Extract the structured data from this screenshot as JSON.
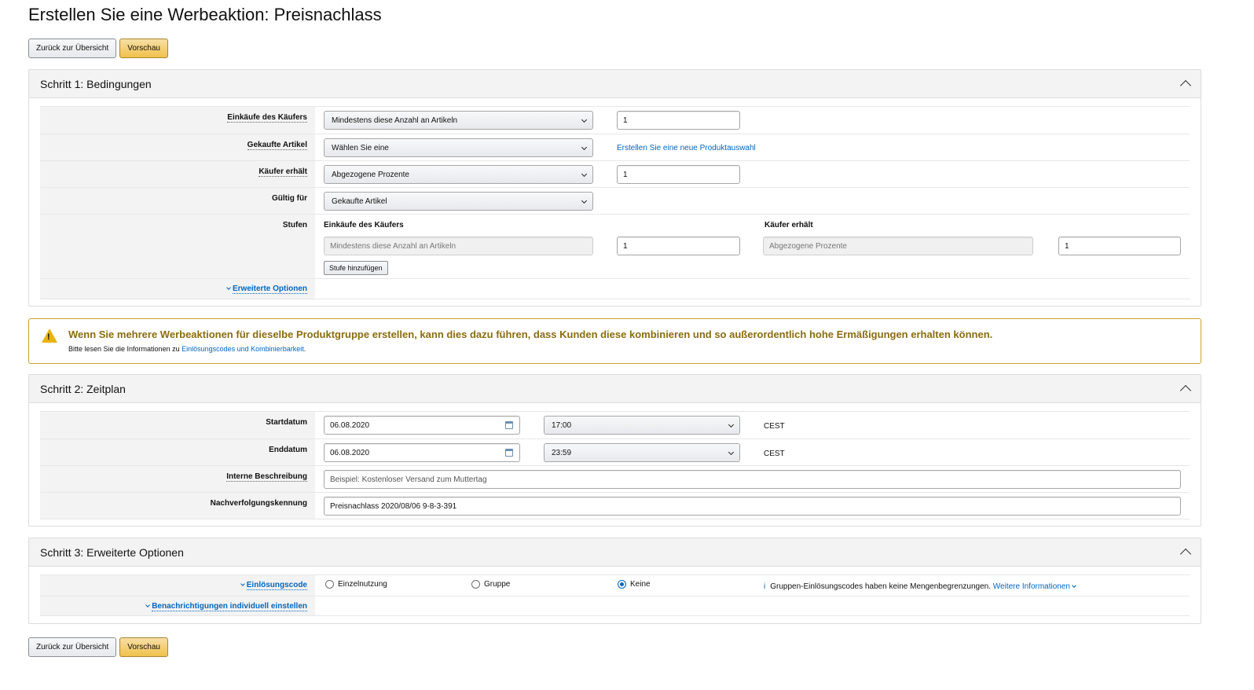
{
  "page": {
    "title": "Erstellen Sie eine Werbeaktion: Preisnachlass"
  },
  "buttons": {
    "back": "Zurück zur Übersicht",
    "preview": "Vorschau"
  },
  "step1": {
    "title": "Schritt 1: Bedingungen",
    "rows": {
      "purchases": {
        "label": "Einkäufe des Käufers",
        "select": "Mindestens diese Anzahl an Artikeln",
        "value": "1"
      },
      "items": {
        "label": "Gekaufte Artikel",
        "select": "Wählen Sie eine",
        "link": "Erstellen Sie eine neue Produktauswahl"
      },
      "receives": {
        "label": "Käufer erhält",
        "select": "Abgezogene Prozente",
        "value": "1"
      },
      "valid": {
        "label": "Gültig für",
        "select": "Gekaufte Artikel"
      },
      "tiers": {
        "label": "Stufen",
        "col1_header": "Einkäufe des Käufers",
        "col2_header": "Käufer erhält",
        "purchases_placeholder": "Mindestens diese Anzahl an Artikeln",
        "purchases_value": "1",
        "receives_placeholder": "Abgezogene Prozente",
        "receives_value": "1",
        "add_button": "Stufe hinzufügen"
      },
      "advanced": {
        "label": "Erweiterte Optionen"
      }
    }
  },
  "alert": {
    "title": "Wenn Sie mehrere Werbeaktionen für dieselbe Produktgruppe erstellen, kann dies dazu führen, dass Kunden diese kombinieren und so außerordentlich hohe Ermäßigungen erhalten können.",
    "text_prefix": "Bitte lesen Sie die Informationen zu",
    "link": "Einlösungscodes und Kombinierbarkeit",
    "text_suffix": ".",
    "icon_glyph": "!"
  },
  "step2": {
    "title": "Schritt 2: Zeitplan",
    "rows": {
      "start": {
        "label": "Startdatum",
        "date": "06.08.2020",
        "time": "17:00",
        "tz": "CEST"
      },
      "end": {
        "label": "Enddatum",
        "date": "06.08.2020",
        "time": "23:59",
        "tz": "CEST"
      },
      "internal": {
        "label": "Interne Beschreibung",
        "placeholder": "Beispiel: Kostenloser Versand zum Muttertag"
      },
      "tracking": {
        "label": "Nachverfolgungskennung",
        "value": "Preisnachlass 2020/08/06 9-8-3-391"
      }
    }
  },
  "step3": {
    "title": "Schritt 3: Erweiterte Optionen",
    "rows": {
      "code": {
        "label": "Einlösungscode",
        "options": [
          "Einzelnutzung",
          "Gruppe",
          "Keine"
        ],
        "selected": "Keine",
        "info_glyph": "i",
        "info_text": "Gruppen-Einlösungscodes haben keine Mengenbegrenzungen.",
        "info_link": "Weitere Informationen"
      },
      "notify": {
        "label": "Benachrichtigungen individuell einstellen"
      }
    }
  },
  "colors": {
    "link": "#0066c0",
    "primary_button": "#f0c14b",
    "alert_border": "#c9a130",
    "alert_title": "#8a6d0e"
  }
}
